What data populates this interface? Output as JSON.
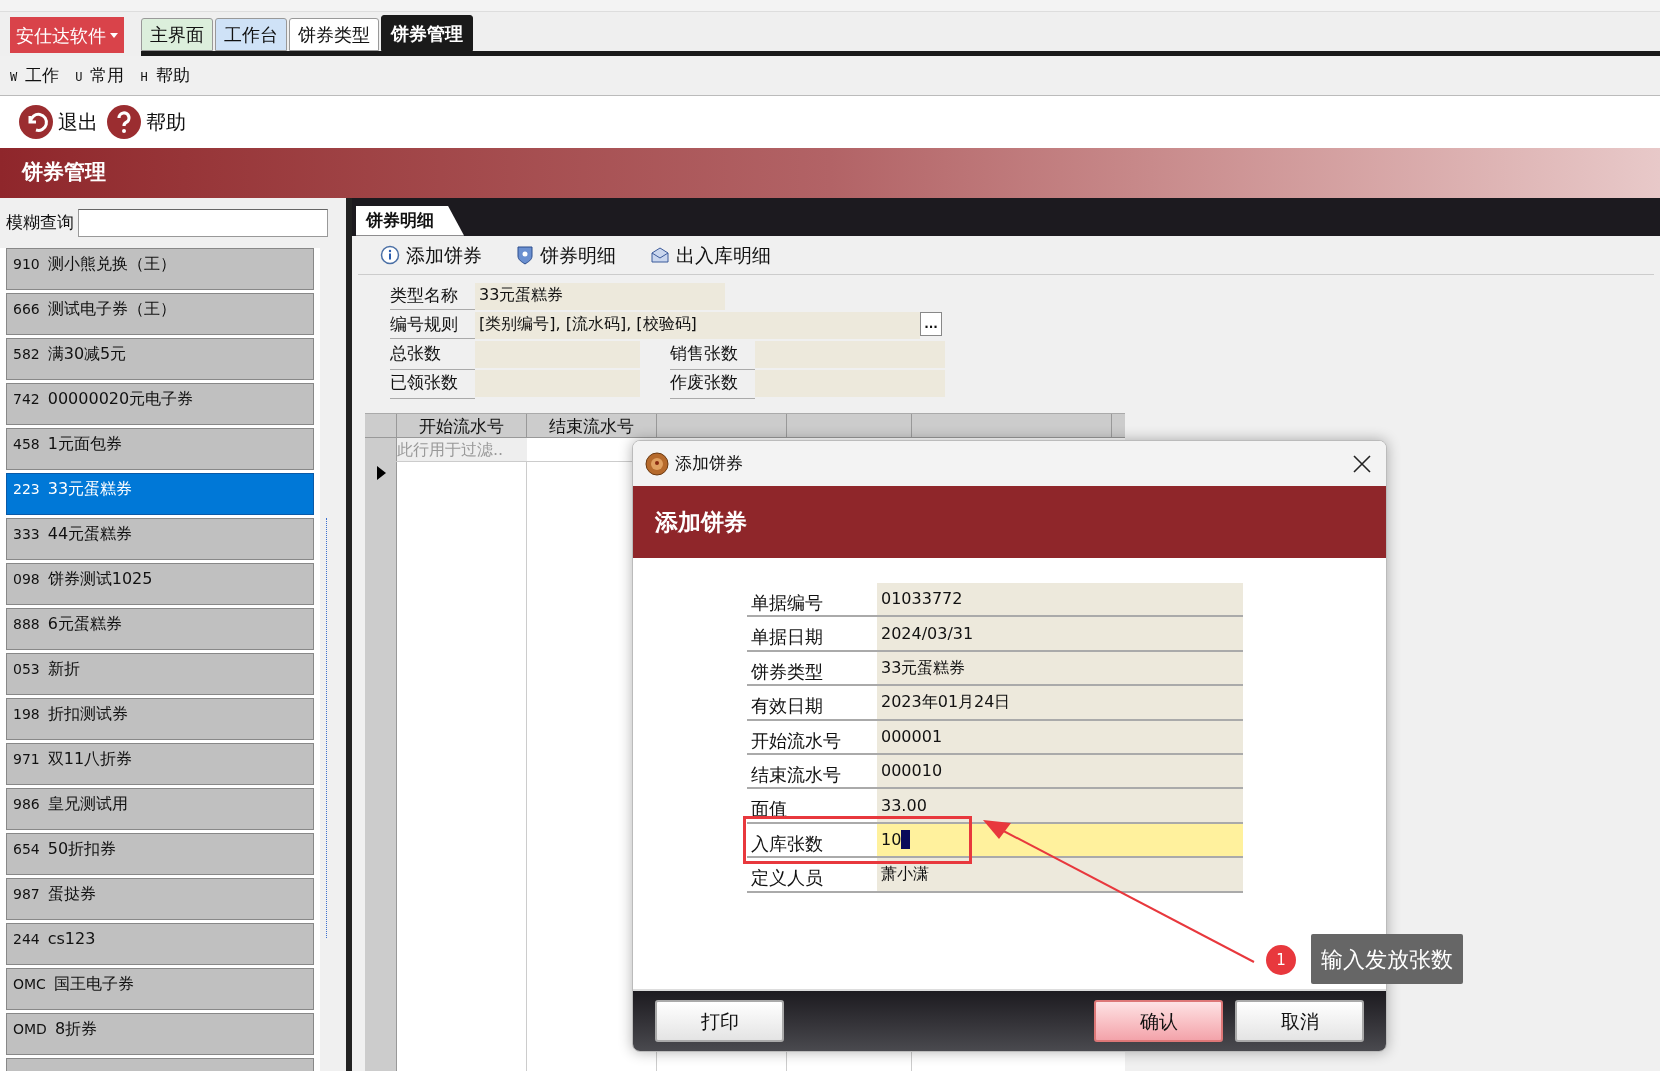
{
  "app_menu": {
    "label": "安仕达软件"
  },
  "tabs": [
    {
      "label": "主界面",
      "selected": false,
      "color": "#dcefdc"
    },
    {
      "label": "工作台",
      "selected": false,
      "color": "#cfe2f7"
    },
    {
      "label": "饼券类型",
      "selected": false,
      "color": "#ffffff"
    },
    {
      "label": "饼券管理",
      "selected": true
    }
  ],
  "menu": [
    {
      "key": "W",
      "label": "工作"
    },
    {
      "key": "U",
      "label": "常用"
    },
    {
      "key": "H",
      "label": "帮助"
    }
  ],
  "toolbar": [
    {
      "kind": "exit",
      "label": "退出"
    },
    {
      "kind": "help",
      "label": "帮助"
    }
  ],
  "page_title": "饼券管理",
  "sidebar": {
    "search_label": "模糊查询",
    "items": [
      {
        "code": "910",
        "name": "测小熊兑换（王）",
        "selected": false
      },
      {
        "code": "666",
        "name": "测试电子券（王）",
        "selected": false
      },
      {
        "code": "582",
        "name": "满30减5元",
        "selected": false
      },
      {
        "code": "742",
        "name": "00000020元电子券",
        "selected": false
      },
      {
        "code": "458",
        "name": "1元面包券",
        "selected": false
      },
      {
        "code": "223",
        "name": "33元蛋糕券",
        "selected": true
      },
      {
        "code": "333",
        "name": "44元蛋糕券",
        "selected": false
      },
      {
        "code": "098",
        "name": "饼券测试1025",
        "selected": false
      },
      {
        "code": "888",
        "name": "6元蛋糕券",
        "selected": false
      },
      {
        "code": "053",
        "name": "新折",
        "selected": false
      },
      {
        "code": "198",
        "name": "折扣测试券",
        "selected": false
      },
      {
        "code": "971",
        "name": "双11八折券",
        "selected": false
      },
      {
        "code": "986",
        "name": "皇兄测试用",
        "selected": false
      },
      {
        "code": "654",
        "name": "50折扣券",
        "selected": false
      },
      {
        "code": "987",
        "name": "蛋挞券",
        "selected": false
      },
      {
        "code": "244",
        "name": "cs123",
        "selected": false
      },
      {
        "code": "OMC",
        "name": "国王电子券",
        "selected": false
      },
      {
        "code": "OMD",
        "name": "8折券",
        "selected": false
      }
    ]
  },
  "detail": {
    "tab": "饼券明细",
    "actions": [
      {
        "kind": "info",
        "label": "添加饼券"
      },
      {
        "kind": "shield",
        "label": "饼券明细"
      },
      {
        "kind": "mail",
        "label": "出入库明细"
      }
    ],
    "type_name": {
      "label": "类型名称",
      "value": "33元蛋糕券"
    },
    "number_rule": {
      "label": "编号规则",
      "value": "[类别编号], [流水码], [校验码]",
      "button": "..."
    },
    "counts": [
      {
        "label": "总张数"
      },
      {
        "label": "销售张数"
      },
      {
        "label": "已领张数"
      },
      {
        "label": "作废张数"
      }
    ],
    "grid": {
      "columns": [
        "开始流水号",
        "结束流水号"
      ],
      "filter_hint": "此行用于过滤.."
    }
  },
  "dialog": {
    "title": "添加饼券",
    "header": "添加饼券",
    "fields": [
      {
        "label": "单据编号",
        "value": "01033772",
        "focused": false
      },
      {
        "label": "单据日期",
        "value": "2024/03/31",
        "focused": false
      },
      {
        "label": "饼券类型",
        "value": "33元蛋糕券",
        "focused": false
      },
      {
        "label": "有效日期",
        "value": "2023年01月24日",
        "focused": false
      },
      {
        "label": "开始流水号",
        "value": "000001",
        "focused": false
      },
      {
        "label": "结束流水号",
        "value": "000010",
        "focused": false
      },
      {
        "label": "面值",
        "value": "33.00",
        "focused": false
      },
      {
        "label": "入库张数",
        "value": "10",
        "focused": true
      },
      {
        "label": "定义人员",
        "value": "萧小潇",
        "focused": false
      }
    ],
    "buttons": [
      {
        "label": "打印",
        "kind": "normal"
      },
      {
        "label": "确认",
        "kind": "primary"
      },
      {
        "label": "取消",
        "kind": "normal"
      }
    ]
  },
  "callout": {
    "number": "1",
    "text": "输入发放张数"
  }
}
